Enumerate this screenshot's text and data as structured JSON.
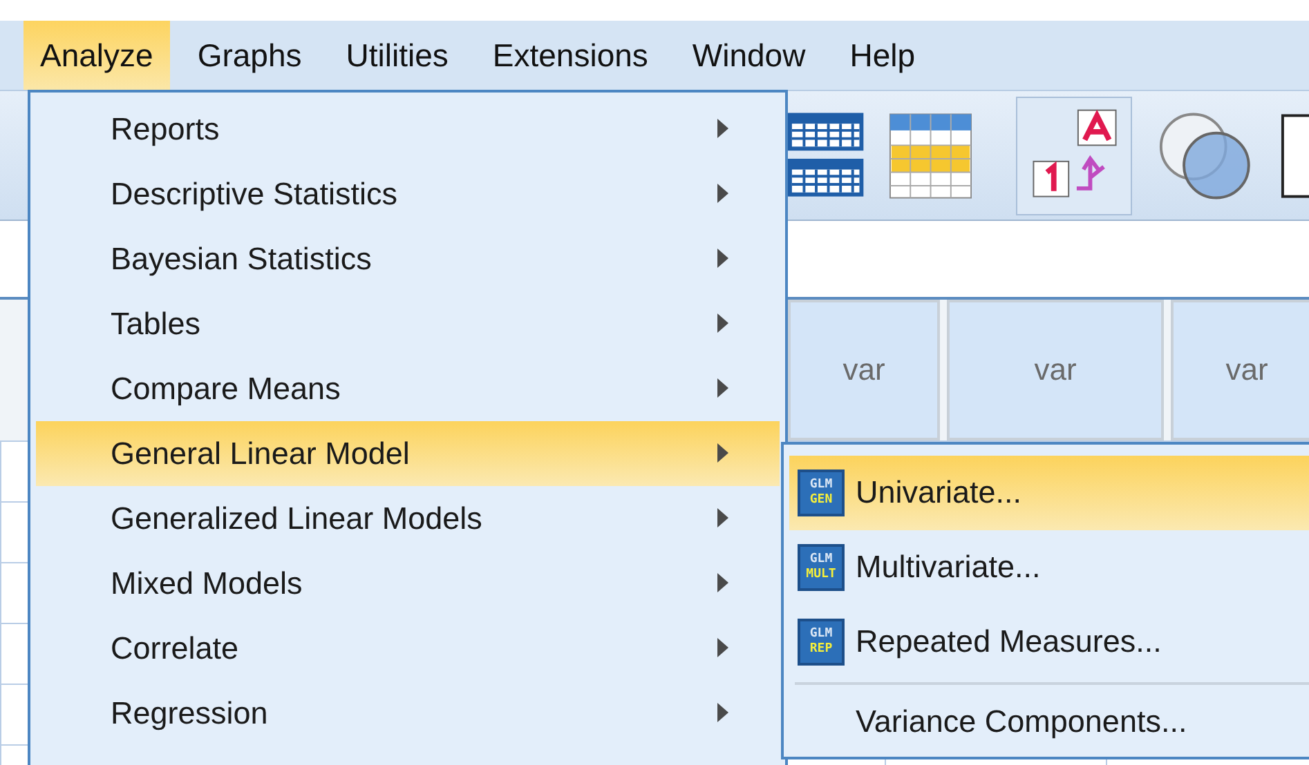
{
  "menubar": [
    {
      "label": "Analyze",
      "selected": true
    },
    {
      "label": "Graphs",
      "selected": false
    },
    {
      "label": "Utilities",
      "selected": false
    },
    {
      "label": "Extensions",
      "selected": false
    },
    {
      "label": "Window",
      "selected": false
    },
    {
      "label": "Help",
      "selected": false
    }
  ],
  "grid": {
    "columns": [
      "var",
      "var",
      "var"
    ]
  },
  "analyze_menu": [
    {
      "label": "Reports",
      "selected": false
    },
    {
      "label": "Descriptive Statistics",
      "selected": false
    },
    {
      "label": "Bayesian Statistics",
      "selected": false
    },
    {
      "label": "Tables",
      "selected": false
    },
    {
      "label": "Compare Means",
      "selected": false
    },
    {
      "label": "General Linear Model",
      "selected": true
    },
    {
      "label": "Generalized Linear Models",
      "selected": false
    },
    {
      "label": "Mixed Models",
      "selected": false
    },
    {
      "label": "Correlate",
      "selected": false
    },
    {
      "label": "Regression",
      "selected": false
    }
  ],
  "glm_submenu": [
    {
      "label": "Univariate...",
      "selected": true,
      "icon_top": "GLM",
      "icon_bottom": "GEN"
    },
    {
      "label": "Multivariate...",
      "selected": false,
      "icon_top": "GLM",
      "icon_bottom": "MULT"
    },
    {
      "label": "Repeated Measures...",
      "selected": false,
      "icon_top": "GLM",
      "icon_bottom": "REP"
    },
    {
      "label": "Variance Components...",
      "selected": false,
      "separator_before": true
    }
  ]
}
